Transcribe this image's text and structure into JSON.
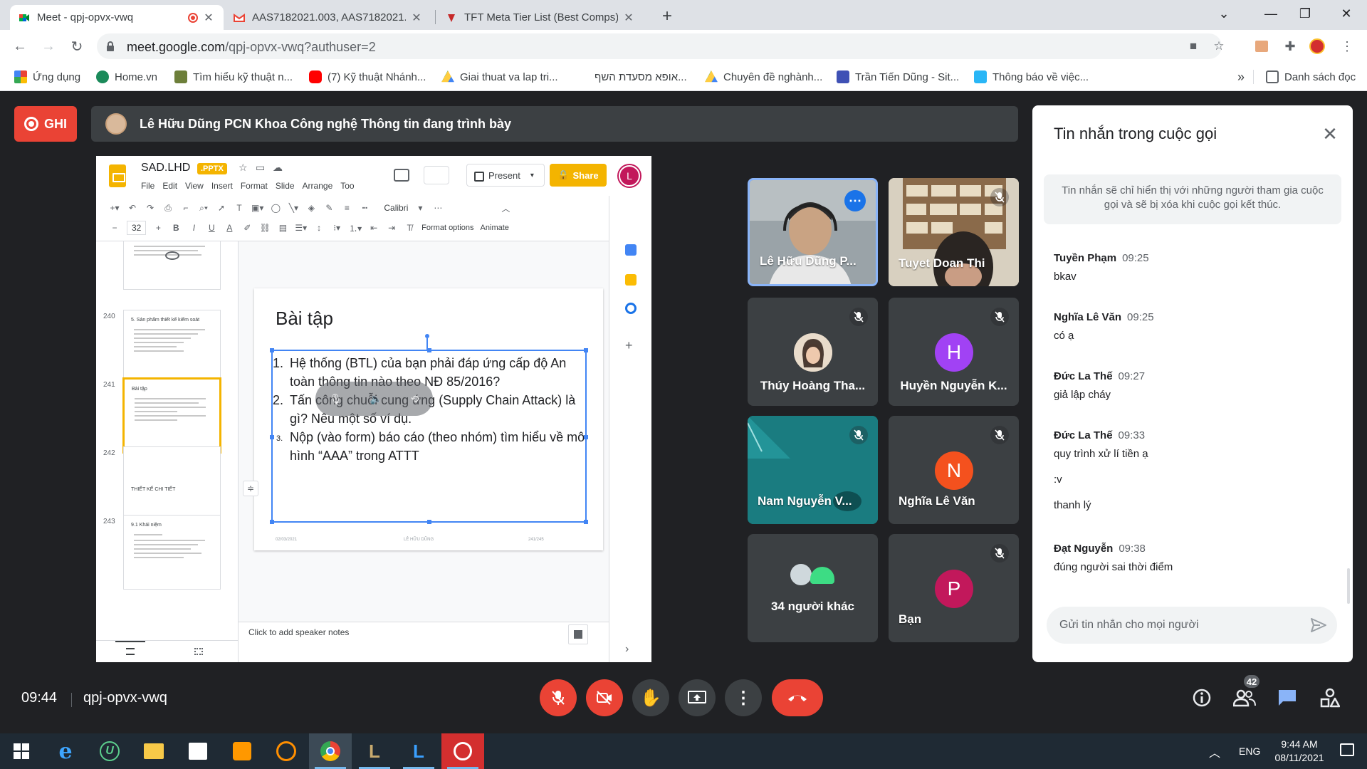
{
  "browser": {
    "tabs": [
      {
        "title": "Meet - qpj-opvx-vwq",
        "active": true
      },
      {
        "title": "AAS7182021.003, AAS7182021.0",
        "active": false
      },
      {
        "title": "TFT Meta Tier List (Best Comps) -",
        "active": false
      }
    ],
    "url_host": "meet.google.com",
    "url_path": "/qpj-opvx-vwq?authuser=2",
    "bookmarks": [
      {
        "label": "Ứng dụng"
      },
      {
        "label": "Home.vn"
      },
      {
        "label": "Tìm hiểu kỹ thuật n..."
      },
      {
        "label": "(7) Kỹ thuật Nhánh..."
      },
      {
        "label": "Giai thuat va lap tri..."
      },
      {
        "label": "אופא מסעדת השף..."
      },
      {
        "label": "Chuyên đề nghành..."
      },
      {
        "label": "Trần Tiến Dũng - Sit..."
      },
      {
        "label": "Thông báo về việc..."
      }
    ],
    "bookmarks_more": "»",
    "reading_list": "Danh sách đọc"
  },
  "meet": {
    "record_label": "GHI",
    "presenter_text": "Lê Hữu Dũng PCN Khoa Công nghệ Thông tin đang trình bày",
    "time": "09:44",
    "meeting_code": "qpj-opvx-vwq",
    "people_count": "42",
    "participants": [
      {
        "name": "Lê Hữu Dũng P..."
      },
      {
        "name": "Tuyet Doan Thi"
      },
      {
        "name": "Thúy Hoàng Tha..."
      },
      {
        "name": "Huyền Nguyễn K...",
        "initial": "H",
        "color": "#a142f4"
      },
      {
        "name": "Nam Nguyễn V..."
      },
      {
        "name": "Nghĩa Lê Văn",
        "initial": "N",
        "color": "#f4511e"
      },
      {
        "name": "34 người khác"
      },
      {
        "name": "Bạn",
        "initial": "P",
        "color": "#c2185b"
      }
    ]
  },
  "slides": {
    "doc_title": "SAD.LHD",
    "badge": ".PPTX",
    "menu": [
      "File",
      "Edit",
      "View",
      "Insert",
      "Format",
      "Slide",
      "Arrange",
      "Too"
    ],
    "present_label": "Present",
    "share_label": "Share",
    "user_initial": "L",
    "font_name": "Calibri",
    "font_size": "32",
    "format_options": "Format options",
    "animate": "Animate",
    "thumb_numbers": [
      "240",
      "241",
      "242",
      "243"
    ],
    "thumb_titles": [
      "5. Sản phẩm thiết kế kiểm soát",
      "Bài tập",
      "THIẾT KẾ CHI TIẾT",
      "9.1 Khái niệm"
    ],
    "slide_title": "Bài tập",
    "items": [
      {
        "n": "1.",
        "text": "Hệ thống (BTL) của bạn phải đáp ứng cấp độ An toàn thông tin nào theo NĐ 85/2016?"
      },
      {
        "n": "2.",
        "text": "Tấn công chuỗi cung ứng (Supply Chain Attack) là gì? Nêu một số ví dụ."
      },
      {
        "n": "3.",
        "text": "Nộp (vào form) báo cáo (theo nhóm) tìm hiểu về mô hình “AAA” trong ATTT"
      }
    ],
    "footer_date": "02/03/2021",
    "footer_author": "LÊ HỮU DŨNG",
    "footer_page": "241/245",
    "speaker_notes": "Click to add speaker notes"
  },
  "chat": {
    "title": "Tin nhắn trong cuộc gọi",
    "notice": "Tin nhắn sẽ chỉ hiển thị với những người tham gia cuộc gọi và sẽ bị xóa khi cuộc gọi kết thúc.",
    "messages": [
      {
        "sender": "Tuyền Phạm",
        "time": "09:25",
        "lines": [
          "bkav"
        ]
      },
      {
        "sender": "Nghĩa Lê Văn",
        "time": "09:25",
        "lines": [
          "có ạ"
        ]
      },
      {
        "sender": "Đức La Thế",
        "time": "09:27",
        "lines": [
          "giả lập cháy"
        ]
      },
      {
        "sender": "Đức La Thế",
        "time": "09:33",
        "lines": [
          "quy trình xử lí tiền ạ",
          ":v",
          "thanh lý"
        ]
      },
      {
        "sender": "Đạt Nguyễn",
        "time": "09:38",
        "lines": [
          "đúng người sai thời điểm"
        ]
      }
    ],
    "input_placeholder": "Gửi tin nhắn cho mọi người"
  },
  "taskbar": {
    "lang": "ENG",
    "clock_time": "9:44 AM",
    "clock_date": "08/11/2021"
  }
}
